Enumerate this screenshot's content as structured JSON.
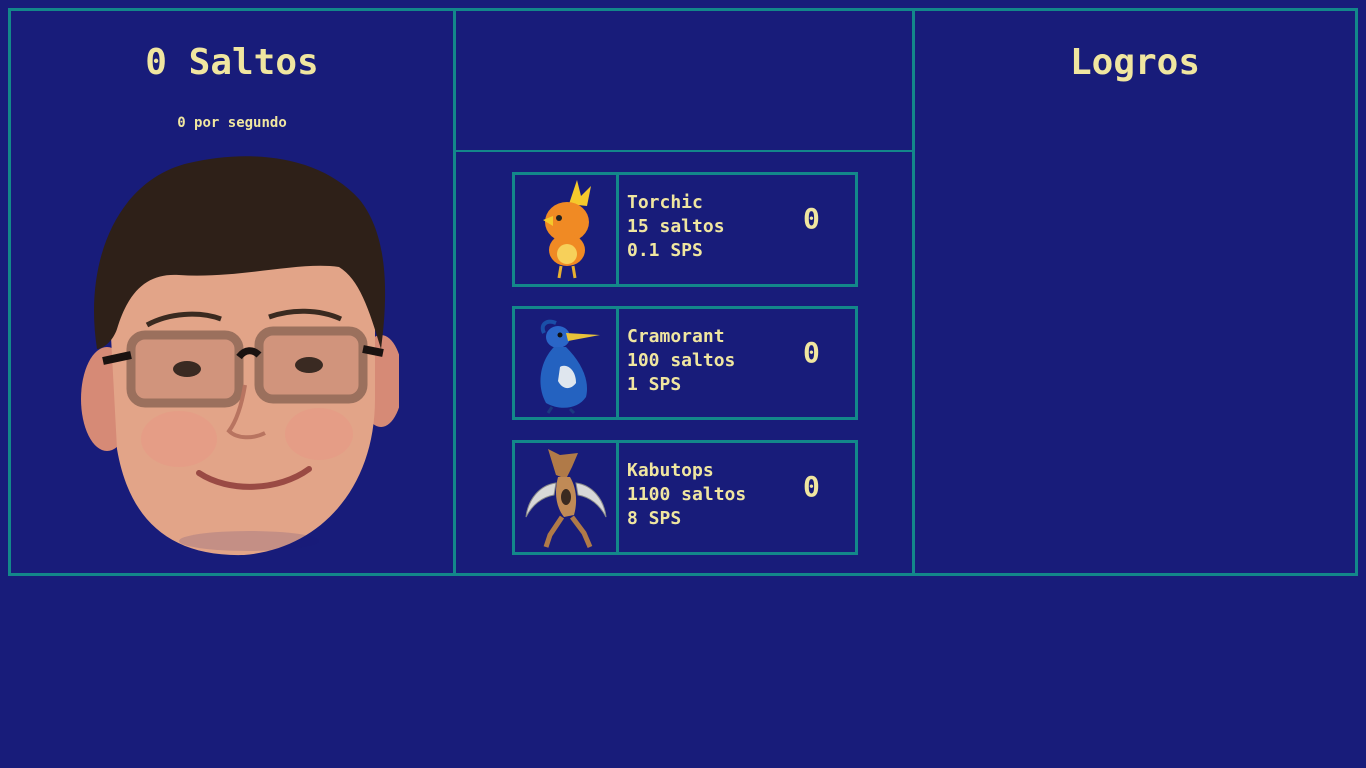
{
  "score": {
    "title": "0 Saltos",
    "rate": "0 por segundo"
  },
  "achievements": {
    "title": "Logros"
  },
  "shop": {
    "items": [
      {
        "name": "Torchic",
        "cost": "15 saltos",
        "sps": "0.1 SPS",
        "owned": "0",
        "sprite": "torchic-sprite"
      },
      {
        "name": "Cramorant",
        "cost": "100 saltos",
        "sps": "1 SPS",
        "owned": "0",
        "sprite": "cramorant-sprite"
      },
      {
        "name": "Kabutops",
        "cost": "1100 saltos",
        "sps": "8 SPS",
        "owned": "0",
        "sprite": "kabutops-sprite"
      }
    ]
  },
  "colors": {
    "background": "#181c7a",
    "border": "#13878a",
    "text": "#f0e6a0"
  }
}
